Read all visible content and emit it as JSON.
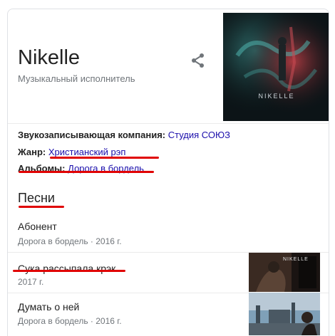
{
  "panel": {
    "title": "Nikelle",
    "subtitle": "Музыкальный исполнитель",
    "image_caption": "NIKELLE"
  },
  "facts": [
    {
      "label": "Звукозаписывающая компания:",
      "value": "Студия СОЮЗ"
    },
    {
      "label": "Жанр:",
      "value": "Христианский рэп"
    },
    {
      "label": "Альбомы:",
      "value": "Дорога в бордель"
    }
  ],
  "songs_section": {
    "title": "Песни",
    "items": [
      {
        "title": "Абонент",
        "meta": "Дорога в бордель · 2016 г."
      },
      {
        "title": "Сука рассыпала крэк",
        "meta": "2017 г.",
        "thumb_caption": "NIKELLE"
      },
      {
        "title": "Думать о ней",
        "meta": "Дорога в бордель · 2016 г."
      }
    ]
  },
  "icons": {
    "share": "share-icon"
  },
  "colors": {
    "link": "#1a0dab",
    "annotation": "#e00000",
    "meta": "#70757a"
  }
}
